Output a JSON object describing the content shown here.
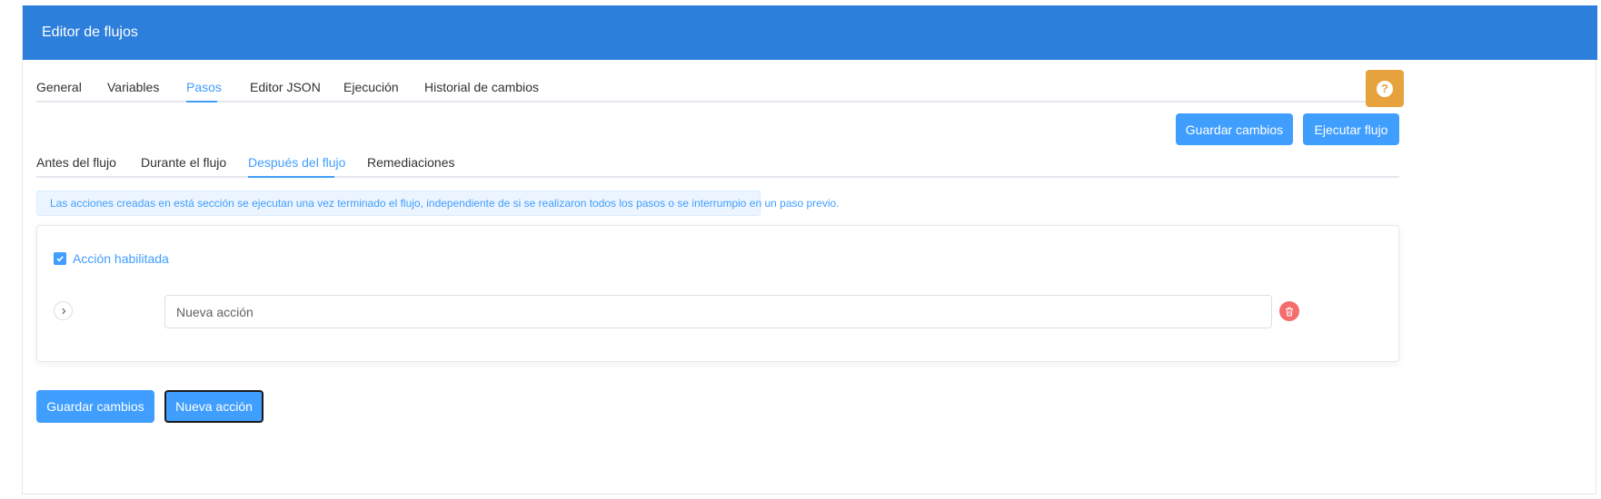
{
  "header": {
    "title": "Editor de flujos"
  },
  "main_tabs": [
    {
      "label": "General",
      "active": false
    },
    {
      "label": "Variables",
      "active": false
    },
    {
      "label": "Pasos",
      "active": true
    },
    {
      "label": "Editor JSON",
      "active": false
    },
    {
      "label": "Ejecución",
      "active": false
    },
    {
      "label": "Historial de cambios",
      "active": false
    }
  ],
  "help_button": {
    "icon": "question-circle-icon",
    "symbol": "?",
    "color": "#e6a23c"
  },
  "toolbar": {
    "save_label": "Guardar cambios",
    "run_label": "Ejecutar flujo"
  },
  "sub_tabs": [
    {
      "label": "Antes del flujo",
      "active": false
    },
    {
      "label": "Durante el flujo",
      "active": false
    },
    {
      "label": "Después del flujo",
      "active": true
    },
    {
      "label": "Remediaciones",
      "active": false
    }
  ],
  "info_alert": {
    "text": "Las acciones creadas en está sección se ejecutan una vez terminado el flujo, independiente de si se realizaron todos los pasos o se interrumpio en un paso previo."
  },
  "action": {
    "enabled_label": "Acción habilitada",
    "enabled": true,
    "name_value": "Nueva acción",
    "expand_icon": "chevron-right-icon",
    "delete_icon": "trash-icon"
  },
  "footer": {
    "save_label": "Guardar cambios",
    "new_action_label": "Nueva acción"
  },
  "colors": {
    "header": "#2d7fdc",
    "primary": "#409eff",
    "warning": "#e6a23c",
    "danger": "#f56c6c"
  }
}
